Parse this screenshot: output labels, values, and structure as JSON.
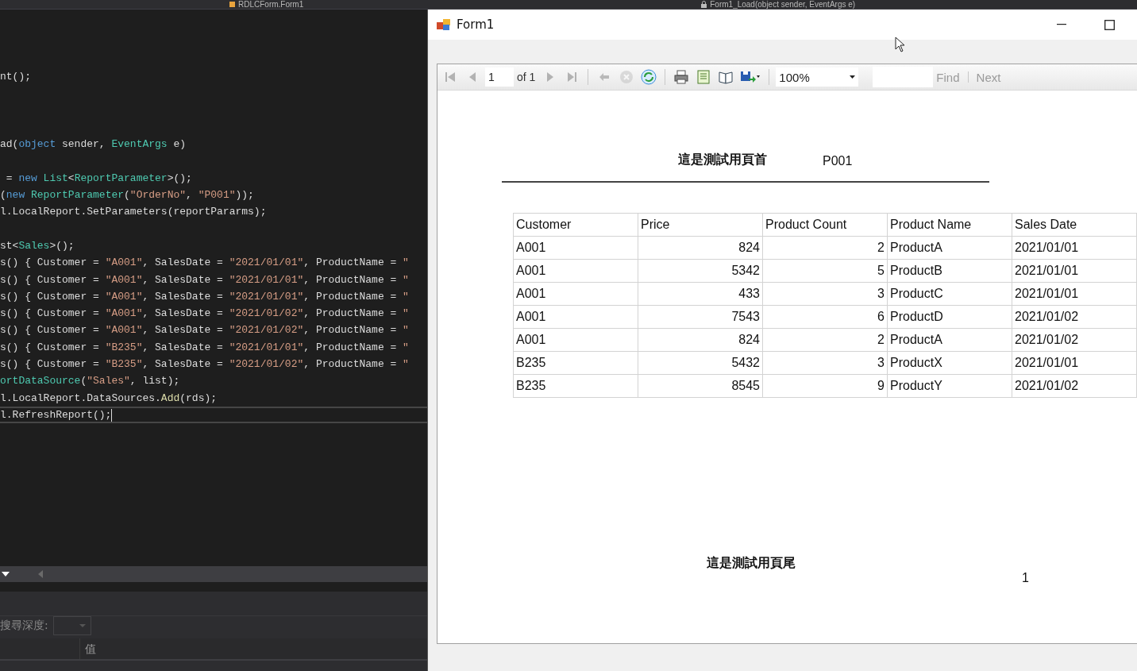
{
  "ide": {
    "tabs": [
      {
        "label": "RDLCForm.Form1"
      },
      {
        "label": "Form1_Load(object sender, EventArgs e)"
      }
    ],
    "code_lines": [
      {
        "kind": "code",
        "current": false,
        "tokens": [
          {
            "kind": "plain",
            "text": "nt();"
          }
        ]
      },
      {
        "kind": "blank"
      },
      {
        "kind": "blank"
      },
      {
        "kind": "blank"
      },
      {
        "kind": "code",
        "current": false,
        "tokens": [
          {
            "kind": "plain",
            "text": "ad("
          },
          {
            "kind": "keyword",
            "text": "object"
          },
          {
            "kind": "plain",
            "text": " sender, "
          },
          {
            "kind": "type",
            "text": "EventArgs"
          },
          {
            "kind": "plain",
            "text": " e)"
          }
        ]
      },
      {
        "kind": "blank"
      },
      {
        "kind": "code",
        "current": false,
        "tokens": [
          {
            "kind": "plain",
            "text": " = "
          },
          {
            "kind": "keyword",
            "text": "new"
          },
          {
            "kind": "type",
            "text": " List"
          },
          {
            "kind": "plain",
            "text": "<"
          },
          {
            "kind": "type",
            "text": "ReportParameter"
          },
          {
            "kind": "plain",
            "text": ">();"
          }
        ]
      },
      {
        "kind": "code",
        "current": false,
        "tokens": [
          {
            "kind": "plain",
            "text": "("
          },
          {
            "kind": "keyword",
            "text": "new"
          },
          {
            "kind": "type",
            "text": " ReportParameter"
          },
          {
            "kind": "plain",
            "text": "("
          },
          {
            "kind": "string",
            "text": "\"OrderNo\""
          },
          {
            "kind": "plain",
            "text": ", "
          },
          {
            "kind": "string",
            "text": "\"P001\""
          },
          {
            "kind": "plain",
            "text": "));"
          }
        ]
      },
      {
        "kind": "code",
        "current": false,
        "tokens": [
          {
            "kind": "plain",
            "text": "l.LocalReport.SetParameters(reportPararms);"
          }
        ]
      },
      {
        "kind": "blank"
      },
      {
        "kind": "code",
        "current": false,
        "tokens": [
          {
            "kind": "plain",
            "text": "st<"
          },
          {
            "kind": "type",
            "text": "Sales"
          },
          {
            "kind": "plain",
            "text": ">();"
          }
        ]
      },
      {
        "kind": "code",
        "current": false,
        "tokens": [
          {
            "kind": "plain",
            "text": "s() { Customer = "
          },
          {
            "kind": "string",
            "text": "\"A001\""
          },
          {
            "kind": "plain",
            "text": ", SalesDate = "
          },
          {
            "kind": "string",
            "text": "\"2021/01/01\""
          },
          {
            "kind": "plain",
            "text": ", ProductName = "
          },
          {
            "kind": "string",
            "text": "\""
          }
        ]
      },
      {
        "kind": "code",
        "current": false,
        "tokens": [
          {
            "kind": "plain",
            "text": "s() { Customer = "
          },
          {
            "kind": "string",
            "text": "\"A001\""
          },
          {
            "kind": "plain",
            "text": ", SalesDate = "
          },
          {
            "kind": "string",
            "text": "\"2021/01/01\""
          },
          {
            "kind": "plain",
            "text": ", ProductName = "
          },
          {
            "kind": "string",
            "text": "\""
          }
        ]
      },
      {
        "kind": "code",
        "current": false,
        "tokens": [
          {
            "kind": "plain",
            "text": "s() { Customer = "
          },
          {
            "kind": "string",
            "text": "\"A001\""
          },
          {
            "kind": "plain",
            "text": ", SalesDate = "
          },
          {
            "kind": "string",
            "text": "\"2021/01/01\""
          },
          {
            "kind": "plain",
            "text": ", ProductName = "
          },
          {
            "kind": "string",
            "text": "\""
          }
        ]
      },
      {
        "kind": "code",
        "current": false,
        "tokens": [
          {
            "kind": "plain",
            "text": "s() { Customer = "
          },
          {
            "kind": "string",
            "text": "\"A001\""
          },
          {
            "kind": "plain",
            "text": ", SalesDate = "
          },
          {
            "kind": "string",
            "text": "\"2021/01/02\""
          },
          {
            "kind": "plain",
            "text": ", ProductName = "
          },
          {
            "kind": "string",
            "text": "\""
          }
        ]
      },
      {
        "kind": "code",
        "current": false,
        "tokens": [
          {
            "kind": "plain",
            "text": "s() { Customer = "
          },
          {
            "kind": "string",
            "text": "\"A001\""
          },
          {
            "kind": "plain",
            "text": ", SalesDate = "
          },
          {
            "kind": "string",
            "text": "\"2021/01/02\""
          },
          {
            "kind": "plain",
            "text": ", ProductName = "
          },
          {
            "kind": "string",
            "text": "\""
          }
        ]
      },
      {
        "kind": "code",
        "current": false,
        "tokens": [
          {
            "kind": "plain",
            "text": "s() { Customer = "
          },
          {
            "kind": "string",
            "text": "\"B235\""
          },
          {
            "kind": "plain",
            "text": ", SalesDate = "
          },
          {
            "kind": "string",
            "text": "\"2021/01/01\""
          },
          {
            "kind": "plain",
            "text": ", ProductName = "
          },
          {
            "kind": "string",
            "text": "\""
          }
        ]
      },
      {
        "kind": "code",
        "current": false,
        "tokens": [
          {
            "kind": "plain",
            "text": "s() { Customer = "
          },
          {
            "kind": "string",
            "text": "\"B235\""
          },
          {
            "kind": "plain",
            "text": ", SalesDate = "
          },
          {
            "kind": "string",
            "text": "\"2021/01/02\""
          },
          {
            "kind": "plain",
            "text": ", ProductName = "
          },
          {
            "kind": "string",
            "text": "\""
          }
        ]
      },
      {
        "kind": "code",
        "current": false,
        "tokens": [
          {
            "kind": "type",
            "text": "ortDataSource"
          },
          {
            "kind": "plain",
            "text": "("
          },
          {
            "kind": "string",
            "text": "\"Sales\""
          },
          {
            "kind": "plain",
            "text": ", list);"
          }
        ]
      },
      {
        "kind": "code",
        "current": false,
        "tokens": [
          {
            "kind": "plain",
            "text": "l.LocalReport.DataSources."
          },
          {
            "kind": "method",
            "text": "Add"
          },
          {
            "kind": "plain",
            "text": "(rds);"
          }
        ]
      },
      {
        "kind": "code",
        "current": true,
        "tokens": [
          {
            "kind": "plain",
            "text": "l.RefreshReport();"
          }
        ]
      }
    ],
    "properties_panel": {
      "search_depth_label": "搜尋深度:",
      "value_column": "值"
    }
  },
  "form": {
    "title": "Form1",
    "toolbar": {
      "buttons": [
        {
          "kind": "first",
          "disabled": true
        },
        {
          "kind": "prev",
          "disabled": true
        },
        {
          "kind": "page"
        },
        {
          "kind": "next",
          "disabled": true
        },
        {
          "kind": "last",
          "disabled": true
        },
        {
          "kind": "sep"
        },
        {
          "kind": "back",
          "disabled": true
        },
        {
          "kind": "stop",
          "disabled": true
        },
        {
          "kind": "refresh",
          "disabled": false
        },
        {
          "kind": "sep"
        },
        {
          "kind": "print",
          "disabled": false
        },
        {
          "kind": "layout",
          "disabled": false
        },
        {
          "kind": "pagesetup",
          "disabled": false
        },
        {
          "kind": "export",
          "disabled": false
        },
        {
          "kind": "sep"
        },
        {
          "kind": "zoom"
        },
        {
          "kind": "find"
        }
      ],
      "page": "1",
      "of_label": "of 1",
      "zoom": "100%",
      "find_label": "Find",
      "next_label": "Next",
      "find_disabled": true
    },
    "report": {
      "header_title": "這是測試用頁首",
      "header_value": "P001",
      "table": {
        "columns": [
          {
            "label": "Customer",
            "kind": "text"
          },
          {
            "label": "Price",
            "kind": "number"
          },
          {
            "label": "Product Count",
            "kind": "number"
          },
          {
            "label": "Product Name",
            "kind": "text"
          },
          {
            "label": "Sales Date",
            "kind": "text"
          }
        ],
        "rows": [
          [
            "A001",
            "824",
            "2",
            "ProductA",
            "2021/01/01"
          ],
          [
            "A001",
            "5342",
            "5",
            "ProductB",
            "2021/01/01"
          ],
          [
            "A001",
            "433",
            "3",
            "ProductC",
            "2021/01/01"
          ],
          [
            "A001",
            "7543",
            "6",
            "ProductD",
            "2021/01/02"
          ],
          [
            "A001",
            "824",
            "2",
            "ProductA",
            "2021/01/02"
          ],
          [
            "B235",
            "5432",
            "3",
            "ProductX",
            "2021/01/01"
          ],
          [
            "B235",
            "8545",
            "9",
            "ProductY",
            "2021/01/02"
          ]
        ]
      },
      "footer_title": "這是測試用頁尾",
      "page_number": "1"
    }
  }
}
